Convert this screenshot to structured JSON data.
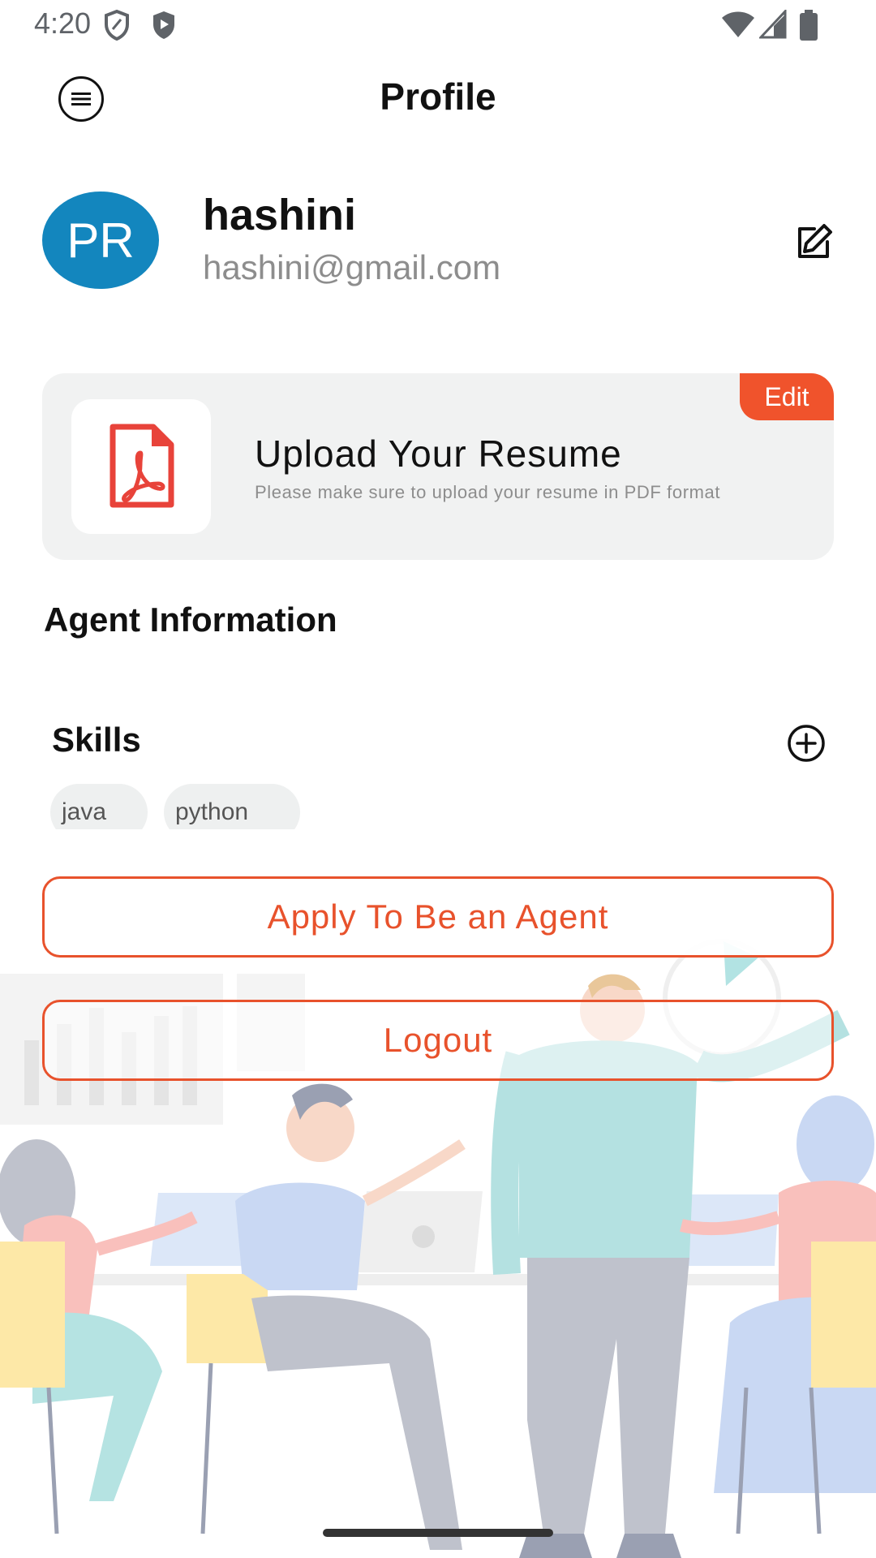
{
  "status_bar": {
    "time": "4:20",
    "icons_left": [
      "shield-outline-icon",
      "shield-filled-icon"
    ],
    "icons_right": [
      "wifi-icon",
      "signal-icon",
      "battery-icon"
    ]
  },
  "app_bar": {
    "title": "Profile",
    "menu_icon": "menu-icon"
  },
  "profile": {
    "initials": "PR",
    "name": "hashini",
    "email": "hashini@gmail.com",
    "edit_icon": "edit-icon"
  },
  "resume": {
    "title": "Upload Your Resume",
    "subtitle": "Please make sure to upload your resume in PDF format",
    "edit_label": "Edit",
    "file_icon": "pdf-file-icon"
  },
  "agent_info": {
    "title": "Agent Information"
  },
  "skills": {
    "title": "Skills",
    "add_icon": "add-circle-icon",
    "items": [
      "java",
      "python"
    ]
  },
  "actions": {
    "apply_label": "Apply To Be an Agent",
    "logout_label": "Logout"
  },
  "colors": {
    "accent": "#f0532c",
    "avatar": "#1386be",
    "card_bg": "#f1f2f2",
    "email_text": "#8d8d8d"
  }
}
